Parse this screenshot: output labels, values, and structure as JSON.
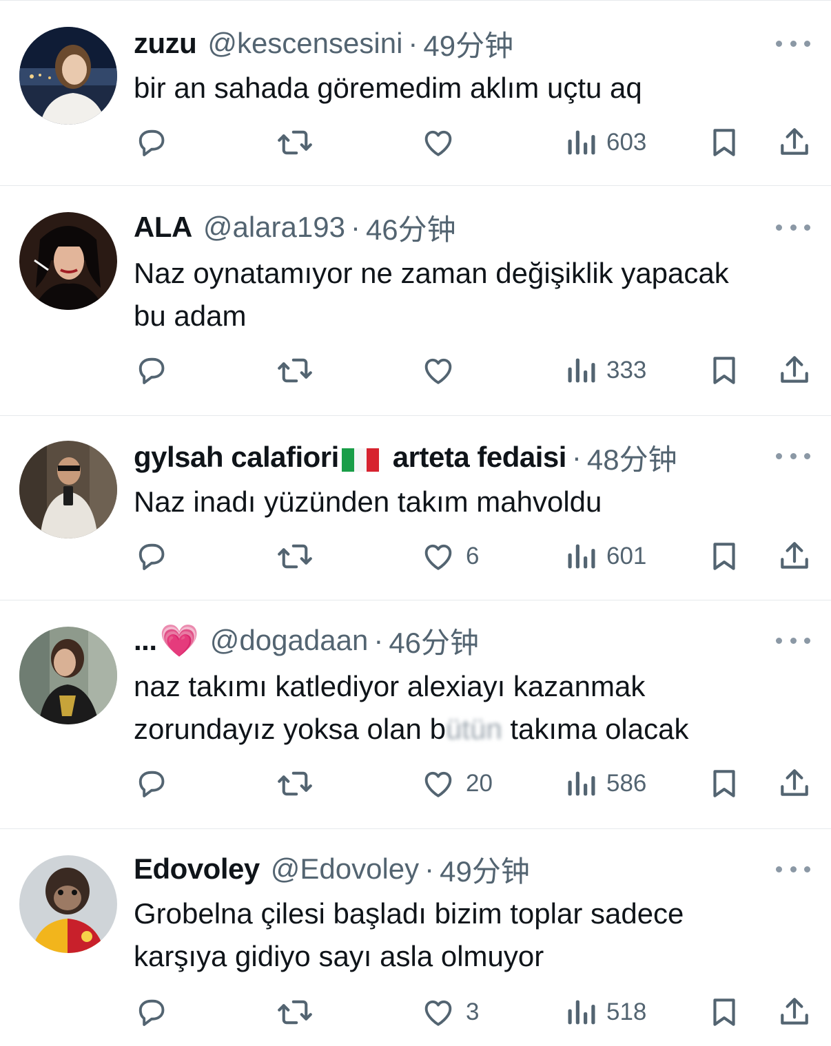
{
  "colors": {
    "text": "#0f1419",
    "muted": "#536471",
    "divider": "#e6e9ec"
  },
  "tweets": [
    {
      "name": "zuzu",
      "handle": "@kescensesini",
      "time": "49分钟",
      "lines": [
        "bir an sahada göremedim aklım uçtu aq"
      ],
      "likes": "",
      "views": "603"
    },
    {
      "name": "ALA",
      "handle": "@alara193",
      "time": "46分钟",
      "lines": [
        "Naz oynatamıyor ne zaman değişiklik yapacak",
        "bu adam"
      ],
      "likes": "",
      "views": "333"
    },
    {
      "name_a": "gylsah calafiori",
      "flag": "italy-flag",
      "name_b": "arteta fedaisi",
      "time": "48分钟",
      "lines": [
        "Naz inadı yüzünden takım mahvoldu"
      ],
      "likes": "6",
      "views": "601"
    },
    {
      "name": "...",
      "emoji": "💗",
      "handle": "@dogadaan",
      "time": "46分钟",
      "lines": [
        "naz takımı katlediyor alexiayı kazanmak"
      ],
      "line2_before": "zorundayız yoksa olan b",
      "line2_blurred": "ütün",
      "line2_after": " takıma olacak",
      "likes": "20",
      "views": "586"
    },
    {
      "name": "Edovoley",
      "handle": "@Edovoley",
      "time": "49分钟",
      "lines": [
        "Grobelna çilesi başladı bizim toplar sadece",
        "karşıya gidiyo sayı asla olmuyor"
      ],
      "likes": "3",
      "views": "518"
    }
  ],
  "sep": "·"
}
